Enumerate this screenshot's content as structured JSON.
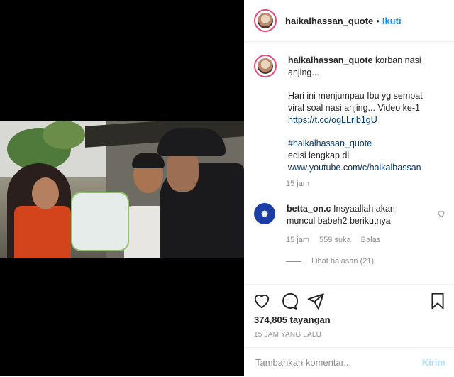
{
  "header": {
    "username": "haikalhassan_quote",
    "separator": "•",
    "follow_label": "Ikuti"
  },
  "caption": {
    "username": "haikalhassan_quote",
    "line1": "korban nasi anjing...",
    "line2": "Hari ini menjumpau Ibu yg sempat viral soal nasi anjing... Video ke-1",
    "link": "https://t.co/ogLLrlb1gU",
    "hashtag": "#haikalhassan_quote",
    "edisi_text": "edisi lengkap di",
    "youtube_link": "www.youtube.com/c/haikalhassan",
    "time": "15 jam"
  },
  "comments": [
    {
      "username": "betta_on.c",
      "text": "Insyaallah akan muncul babeh2 berikutnya",
      "time": "15 jam",
      "likes": "559 suka",
      "reply_label": "Balas",
      "view_replies": "Lihat balasan (21)"
    }
  ],
  "actions": {
    "like_icon": "heart-icon",
    "comment_icon": "comment-icon",
    "share_icon": "paper-plane-icon",
    "save_icon": "bookmark-icon"
  },
  "stats": {
    "views": "374,805 tayangan",
    "time_ago": "15 JAM YANG LALU"
  },
  "add_comment": {
    "placeholder": "Tambahkan komentar...",
    "post_label": "Kirim"
  },
  "colors": {
    "accent": "#0095f6",
    "post_disabled": "#b2dffc",
    "story_ring": "#e84b7a"
  }
}
